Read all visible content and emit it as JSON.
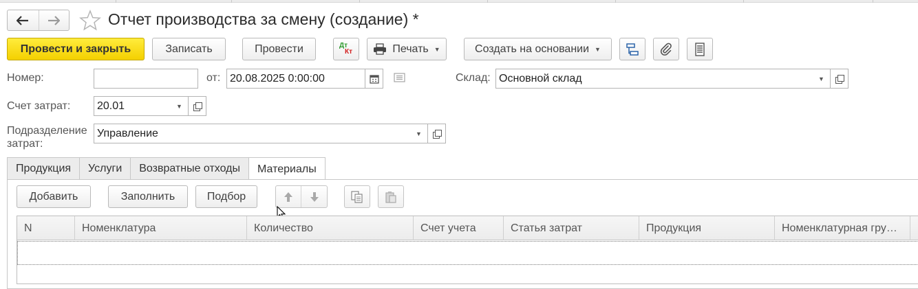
{
  "header": {
    "title": "Отчет производства за смену (создание) *",
    "back_icon": "arrow-left-icon",
    "forward_icon": "arrow-right-icon",
    "favorite_icon": "star-icon"
  },
  "toolbar": {
    "post_close_label": "Провести и закрыть",
    "save_label": "Записать",
    "post_label": "Провести",
    "dtkt_dt": "Дт",
    "dtkt_kt": "Кт",
    "print_label": "Печать",
    "create_based_label": "Создать на основании"
  },
  "form": {
    "number_label": "Номер:",
    "number_value": "",
    "date_label": "от:",
    "date_value": "20.08.2025  0:00:00",
    "warehouse_label": "Склад:",
    "warehouse_value": "Основной склад",
    "account_label": "Счет затрат:",
    "account_value": "20.01",
    "dept_label_line1": "Подразделение",
    "dept_label_line2": "затрат:",
    "dept_value": "Управление"
  },
  "tabs": [
    {
      "label": "Продукция"
    },
    {
      "label": "Услуги"
    },
    {
      "label": "Возвратные отходы"
    },
    {
      "label": "Материалы",
      "active": true
    }
  ],
  "table_toolbar": {
    "add_label": "Добавить",
    "fill_label": "Заполнить",
    "pick_label": "Подбор"
  },
  "table": {
    "columns": [
      {
        "label": "N"
      },
      {
        "label": "Номенклатура"
      },
      {
        "label": "Количество"
      },
      {
        "label": "Счет учета"
      },
      {
        "label": "Статья затрат"
      },
      {
        "label": "Продукция"
      },
      {
        "label": "Номенклатурная гру…"
      },
      {
        "label": "("
      }
    ],
    "rows": []
  },
  "colors": {
    "primary_button": "#f4d000",
    "dt_color": "#2e9b2e",
    "kt_color": "#d22020"
  }
}
